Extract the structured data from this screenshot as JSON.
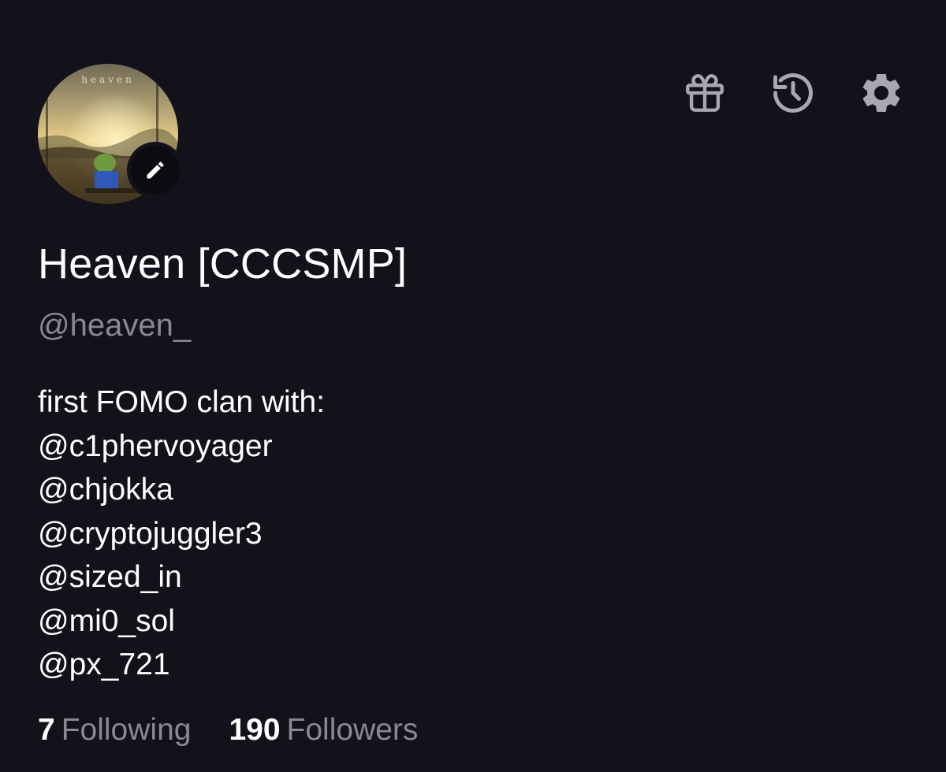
{
  "profile": {
    "avatar_text": "heaven",
    "display_name": "Heaven [CCCSMP]",
    "handle": "@heaven_",
    "bio_lines": [
      "first FOMO clan with:",
      "@c1phervoyager",
      "@chjokka",
      "@cryptojuggler3",
      "@sized_in",
      "@mi0_sol",
      "@px_721"
    ]
  },
  "stats": {
    "following_count": "7",
    "following_label": "Following",
    "followers_count": "190",
    "followers_label": "Followers"
  },
  "icons": {
    "edit": "pencil-icon",
    "gift": "gift-icon",
    "history": "history-icon",
    "settings": "gear-icon"
  },
  "colors": {
    "background": "#13121b",
    "text": "#ffffff",
    "muted": "#8a8992",
    "icon": "#a9a8b0"
  }
}
